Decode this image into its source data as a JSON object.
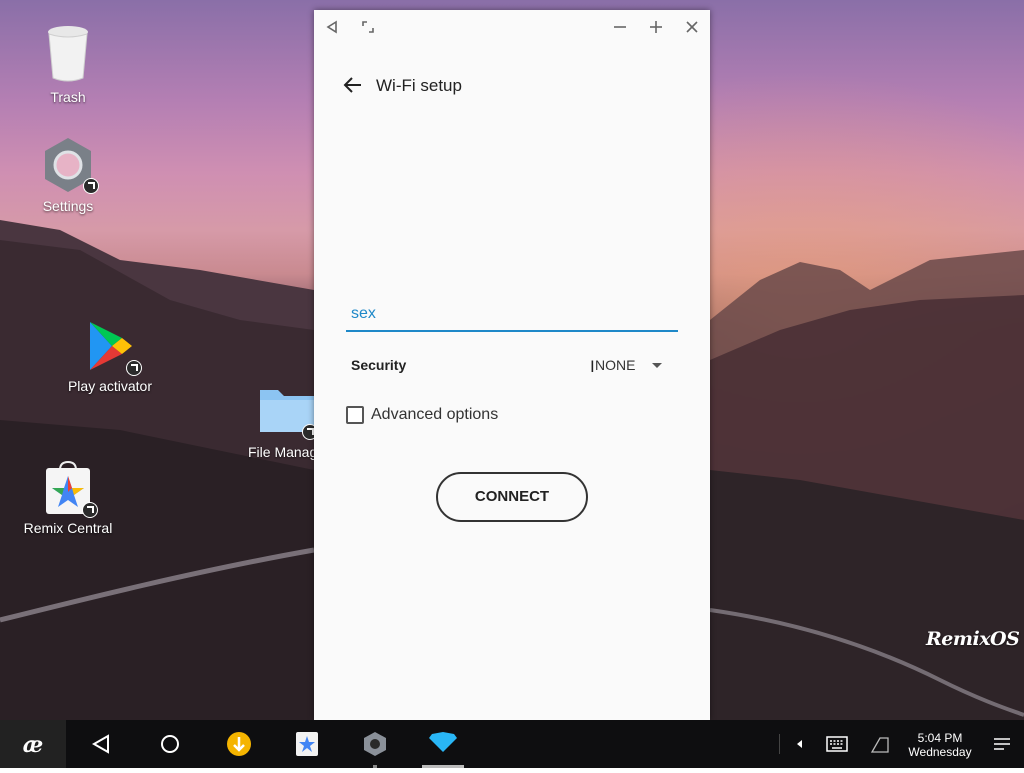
{
  "desktop": {
    "icons": [
      {
        "label": "Trash"
      },
      {
        "label": "Settings"
      },
      {
        "label": "Play activator"
      },
      {
        "label": "File Manag"
      },
      {
        "label": "Remix Central"
      }
    ],
    "watermark": "RemixOS"
  },
  "window": {
    "titlebar": {
      "back_icon": "triangle-left-icon",
      "resize_icon": "resize-icon",
      "minimize_icon": "minus-icon",
      "maximize_icon": "plus-icon",
      "close_icon": "close-icon"
    },
    "header": {
      "title": "Wi-Fi setup"
    },
    "form": {
      "ssid_value": "sex",
      "security_label": "Security",
      "security_value": "NONE",
      "advanced_label": "Advanced options",
      "advanced_checked": false,
      "connect_label": "CONNECT"
    }
  },
  "taskbar": {
    "clock_time": "5:04 PM",
    "clock_day": "Wednesday"
  },
  "colors": {
    "accent": "#1e88c8",
    "taskbar": "#0e0e10",
    "window_bg": "#fafafa"
  }
}
